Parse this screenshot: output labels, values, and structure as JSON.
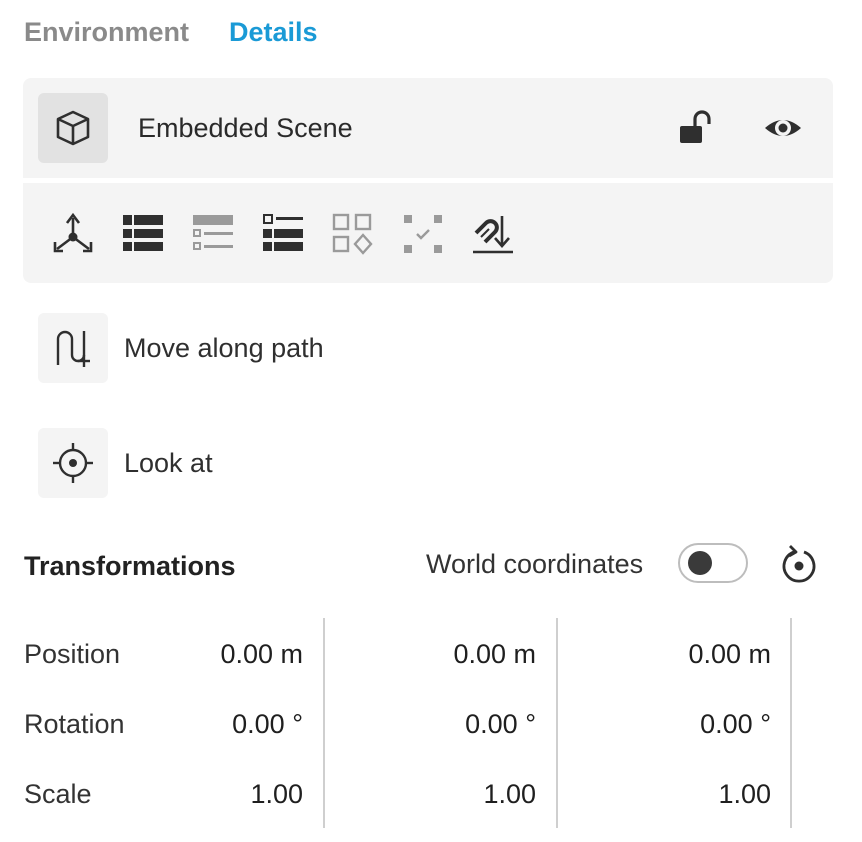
{
  "tabs": [
    {
      "label": "Environment",
      "active": false
    },
    {
      "label": "Details",
      "active": true
    }
  ],
  "colors": {
    "accent": "#1a9ad6",
    "card_bg": "#f4f4f4",
    "icon_dark": "#2f2f2f",
    "icon_muted": "#9a9a9a"
  },
  "scene": {
    "title": "Embedded Scene",
    "icon": "cube-icon",
    "lock_icon": "unlock-icon",
    "visibility_icon": "eye-icon"
  },
  "toolbar": {
    "tools": [
      {
        "icon": "axes-gizmo-icon",
        "enabled": true
      },
      {
        "icon": "list-icon",
        "enabled": true
      },
      {
        "icon": "list-outline-icon",
        "enabled": false
      },
      {
        "icon": "list-checklist-icon",
        "enabled": true
      },
      {
        "icon": "shapes-grid-icon",
        "enabled": false
      },
      {
        "icon": "select-points-icon",
        "enabled": false
      },
      {
        "icon": "snap-magnet-icon",
        "enabled": true
      }
    ]
  },
  "actions": [
    {
      "label": "Move along path",
      "icon": "path-plus-icon"
    },
    {
      "label": "Look at",
      "icon": "target-icon"
    }
  ],
  "transformations": {
    "title": "Transformations",
    "world_coordinates_label": "World coordinates",
    "world_coordinates_enabled": false,
    "reset_icon": "reset-rotate-icon",
    "rows": [
      {
        "label": "Position",
        "values": [
          "0.00 m",
          "0.00 m",
          "0.00 m"
        ]
      },
      {
        "label": "Rotation",
        "values": [
          "0.00 °",
          "0.00 °",
          "0.00 °"
        ]
      },
      {
        "label": "Scale",
        "values": [
          "1.00",
          "1.00",
          "1.00"
        ]
      }
    ]
  }
}
